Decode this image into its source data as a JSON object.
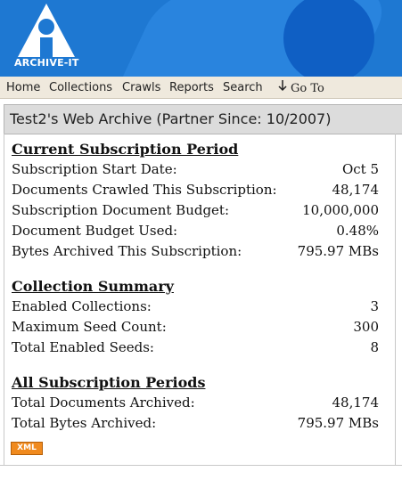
{
  "brand": {
    "logo_text": "ARCHIVE-IT",
    "colors": {
      "banner": "#1e78d2",
      "circle": "#0f5fc4",
      "nav_bg": "#efe9dd",
      "xml_badge": "#f08a1e"
    }
  },
  "nav": {
    "items": [
      "Home",
      "Collections",
      "Crawls",
      "Reports",
      "Search"
    ],
    "goto_label": "Go To",
    "goto_icon": "down-arrow-icon"
  },
  "title": "Test2's Web Archive (Partner Since: 10/2007)",
  "sections": [
    {
      "heading": "Current Subscription Period",
      "rows": [
        {
          "label": "Subscription Start Date:",
          "value": "Oct 5"
        },
        {
          "label": "Documents Crawled This Subscription:",
          "value": "48,174"
        },
        {
          "label": "Subscription Document Budget:",
          "value": "10,000,000"
        },
        {
          "label": "Document Budget Used:",
          "value": "0.48%"
        },
        {
          "label": "Bytes Archived This Subscription:",
          "value": "795.97 MBs"
        }
      ]
    },
    {
      "heading": "Collection Summary",
      "rows": [
        {
          "label": "Enabled Collections:",
          "value": "3"
        },
        {
          "label": "Maximum Seed Count:",
          "value": "300"
        },
        {
          "label": "Total Enabled Seeds:",
          "value": "8"
        }
      ]
    },
    {
      "heading": "All Subscription Periods",
      "rows": [
        {
          "label": "Total Documents Archived:",
          "value": "48,174"
        },
        {
          "label": "Total Bytes Archived:",
          "value": "795.97 MBs"
        }
      ]
    }
  ],
  "xml_badge": "XML"
}
